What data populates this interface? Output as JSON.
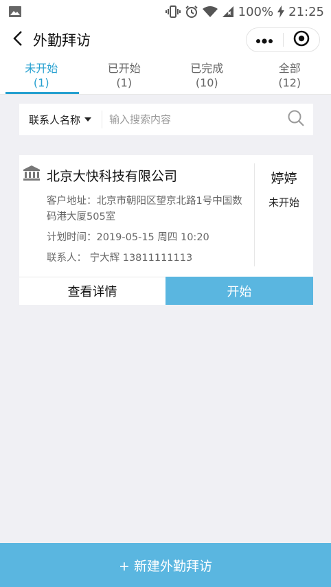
{
  "status_bar": {
    "battery": "100%",
    "time": "21:25"
  },
  "nav": {
    "title": "外勤拜访"
  },
  "tabs": [
    {
      "label": "未开始",
      "count": "(1)",
      "active": true
    },
    {
      "label": "已开始",
      "count": "(1)",
      "active": false
    },
    {
      "label": "已完成",
      "count": "(10)",
      "active": false
    },
    {
      "label": "全部",
      "count": "(12)",
      "active": false
    }
  ],
  "search": {
    "filter_label": "联系人名称",
    "placeholder": "输入搜索内容"
  },
  "visits": [
    {
      "company": "北京大快科技有限公司",
      "address_label": "客户地址：",
      "address_line1": "北京市朝阳区望京北路1号中国数",
      "address_line2": "码港大厦505室",
      "time_label": "计划时间：",
      "time": "2019-05-15 周四 10:20",
      "contact_label": "联系人：",
      "contact": "宁大辉 13811111113",
      "assignee": "婷婷",
      "status": "未开始",
      "detail_button": "查看详情",
      "start_button": "开始"
    }
  ],
  "bottom_button": "+ 新建外勤拜访",
  "colors": {
    "accent": "#26a0d0",
    "button": "#5ab6e0",
    "background": "#f0f0f4"
  }
}
